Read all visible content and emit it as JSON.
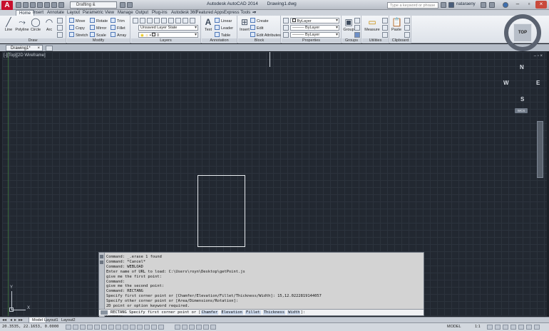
{
  "app": {
    "logo_letter": "A",
    "title": "Autodesk AutoCAD 2014",
    "file": "Drawing1.dwg",
    "workspace": "Drafting & Annotation",
    "search_placeholder": "Type a keyword or phrase",
    "user": "nataraeny"
  },
  "ribbon_tabs": [
    "Home",
    "Insert",
    "Annotate",
    "Layout",
    "Parametric",
    "View",
    "Manage",
    "Output",
    "Plug-ins",
    "Autodesk 360",
    "Featured Apps",
    "Express Tools",
    "▪▾"
  ],
  "draw": {
    "title": "Draw",
    "tools": [
      "Line",
      "Polyline",
      "Circle",
      "Arc"
    ]
  },
  "modify": {
    "title": "Modify",
    "tools": [
      "Move",
      "Rotate",
      "Trim",
      "Copy",
      "Mirror",
      "Fillet",
      "Stretch",
      "Scale",
      "Array"
    ]
  },
  "layers": {
    "title": "Layers",
    "state": "Unsaved Layer State",
    "current": "0"
  },
  "annotation": {
    "title": "Annotation",
    "text": "Text",
    "linear": "Linear",
    "leader": "Leader",
    "table": "Table"
  },
  "block": {
    "title": "Block",
    "insert": "Insert",
    "create": "Create",
    "edit": "Edit",
    "edit_attributes": "Edit Attributes"
  },
  "properties": {
    "title": "Properties",
    "color": "ByLayer",
    "linetype": "ByLayer",
    "lineweight": "ByLayer"
  },
  "groups": {
    "title": "Groups",
    "group": "Group"
  },
  "utilities": {
    "title": "Utilities",
    "measure": "Measure"
  },
  "clipboard": {
    "title": "Clipboard",
    "paste": "Paste"
  },
  "file_tabs": {
    "active": "Drawing1*",
    "close": "×"
  },
  "viewport": {
    "label": "[-][Top][2D Wireframe]",
    "controls": "– ▫ ×"
  },
  "viewcube": {
    "face": "TOP",
    "n": "N",
    "s": "S",
    "e": "E",
    "w": "W",
    "wcs": "WCS"
  },
  "ucs": {
    "x": "X",
    "y": "Y"
  },
  "command_history": [
    "Command: _.erase 1 found",
    "Command: *Cancel*",
    "Command: WEBLOAD",
    "Enter name of URL to load: C:\\Users\\royn\\Desktop\\getPoint.js",
    "give me the first point:",
    "Command:",
    "give me the second point:",
    "Command: RECTANG",
    "Specify first corner point or [Chamfer/Elevation/Fillet/Thickness/Width]: 15,12.0222819144057",
    "Specify other corner point or [Area/Dimensions/Rotation]:",
    "2D point or option keyword required.",
    "Specify other corner point or [Area/Dimensions/Rotation]: 18.8953888500047,4.158700905289757",
    "Command:",
    "RECTANG"
  ],
  "command_prompt": {
    "prefix": "RECTANG Specify first corner point or [",
    "options": [
      "Chamfer",
      "Elevation",
      "Fillet",
      "Thickness",
      "Width"
    ],
    "suffix": "]:"
  },
  "layout_tabs": [
    "Model",
    "Layout1",
    "Layout2"
  ],
  "status": {
    "coords": "20.3535, 22.1653, 0.0000",
    "model": "MODEL",
    "scale": "1:1"
  }
}
